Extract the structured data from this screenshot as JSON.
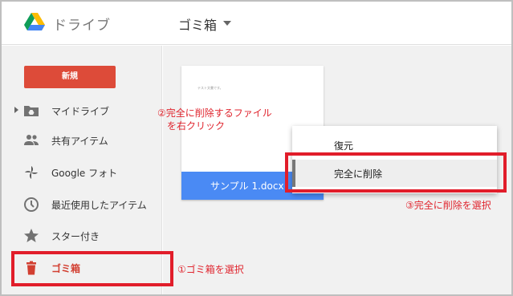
{
  "header": {
    "app_title": "ドライブ",
    "location": "ゴミ箱"
  },
  "sidebar": {
    "new_label": "新規",
    "items": [
      {
        "label": "マイドライブ",
        "icon": "drive-folder-icon"
      },
      {
        "label": "共有アイテム",
        "icon": "people-icon"
      },
      {
        "label": "Google フォト",
        "icon": "photos-pinwheel-icon"
      },
      {
        "label": "最近使用したアイテム",
        "icon": "clock-icon"
      },
      {
        "label": "スター付き",
        "icon": "star-icon"
      },
      {
        "label": "ゴミ箱",
        "icon": "trash-icon"
      }
    ]
  },
  "file": {
    "name": "サンプル 1.docx",
    "thumb_text": "テスト文書です。"
  },
  "context_menu": {
    "items": [
      "復元",
      "完全に削除"
    ]
  },
  "annotations": {
    "step1": "①ゴミ箱を選択",
    "step2_line1": "②完全に削除するファイル",
    "step2_line2": "を右クリック",
    "step3": "③完全に削除を選択"
  },
  "colors": {
    "accent_red": "#dd4b39",
    "annotation_red": "#e11d2a",
    "file_bar_blue": "#4a8af4"
  }
}
